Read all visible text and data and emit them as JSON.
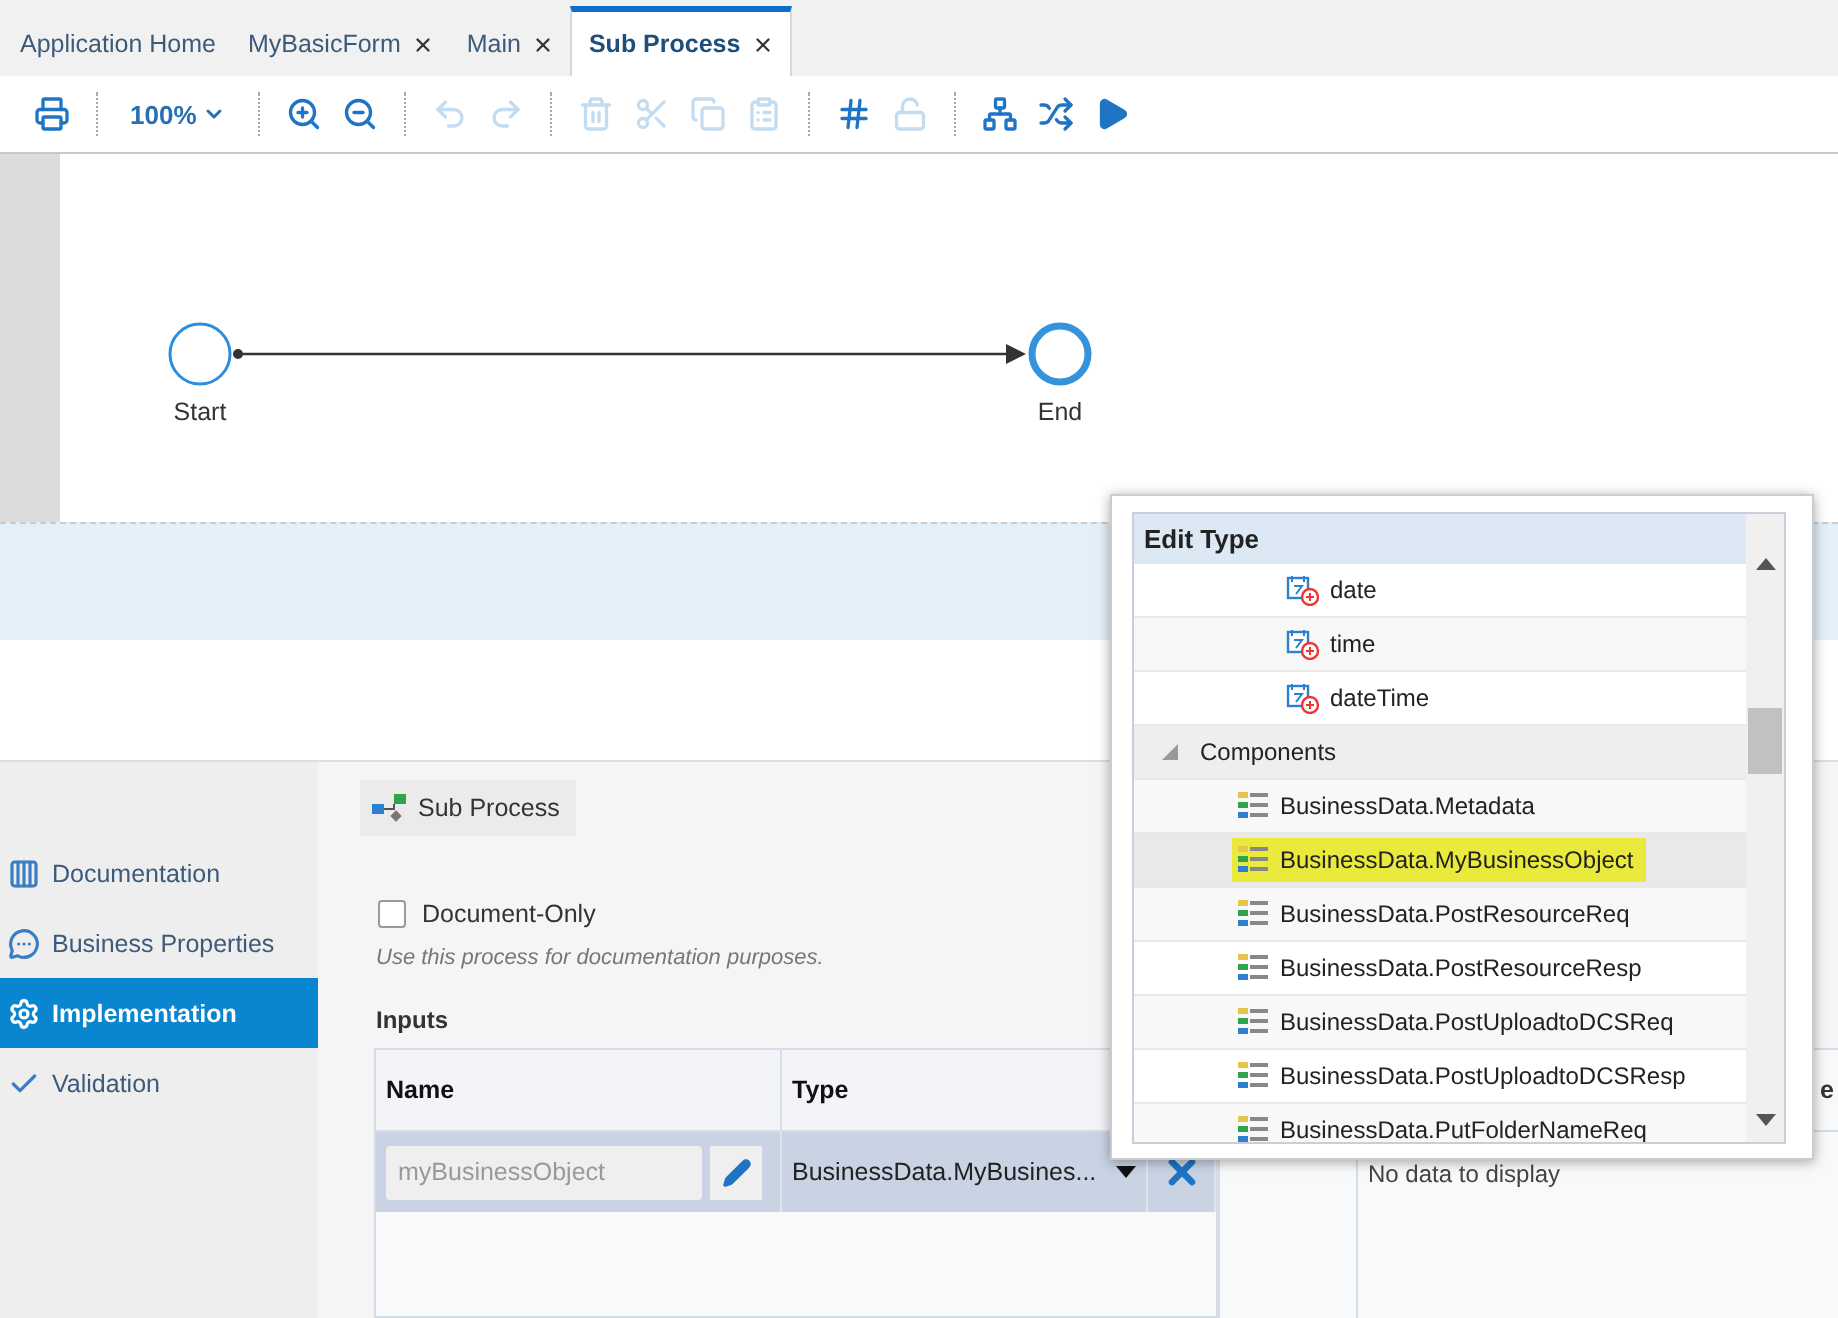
{
  "tabs": [
    {
      "label": "Application Home",
      "closable": false,
      "selected": false
    },
    {
      "label": "MyBasicForm",
      "closable": true,
      "selected": false
    },
    {
      "label": "Main",
      "closable": true,
      "selected": false
    },
    {
      "label": "Sub Process",
      "closable": true,
      "selected": true
    }
  ],
  "toolbar": {
    "zoom": "100%",
    "tools": [
      {
        "kind": "print",
        "disabled": false
      },
      {
        "kind": "zoom-in",
        "disabled": false
      },
      {
        "kind": "zoom-out",
        "disabled": false
      },
      {
        "kind": "undo",
        "disabled": true
      },
      {
        "kind": "redo",
        "disabled": true
      },
      {
        "kind": "delete",
        "disabled": true
      },
      {
        "kind": "cut",
        "disabled": true
      },
      {
        "kind": "copy",
        "disabled": true
      },
      {
        "kind": "paste",
        "disabled": true
      },
      {
        "kind": "grid",
        "disabled": false
      },
      {
        "kind": "lock",
        "disabled": true
      },
      {
        "kind": "connect",
        "disabled": false
      },
      {
        "kind": "shuffle",
        "disabled": false
      },
      {
        "kind": "run",
        "disabled": false
      }
    ]
  },
  "diagram": {
    "start": "Start",
    "end": "End"
  },
  "sidebar": {
    "items": [
      {
        "label": "Documentation",
        "selected": false
      },
      {
        "label": "Business Properties",
        "selected": false
      },
      {
        "label": "Implementation",
        "selected": true
      },
      {
        "label": "Validation",
        "selected": false
      }
    ]
  },
  "panel": {
    "chip": "Sub Process",
    "checkbox": {
      "label": "Document-Only",
      "checked": false
    },
    "hint": "Use this process for documentation purposes.",
    "inputs": {
      "title": "Inputs",
      "columns": [
        "Name",
        "Type"
      ],
      "rows": [
        {
          "name": "myBusinessObject",
          "type": "BusinessData.MyBusines..."
        }
      ]
    },
    "outputs": {
      "column_2": "e",
      "empty": "No data to display"
    }
  },
  "popup": {
    "title": "Edit Type",
    "items": [
      {
        "label": "date",
        "kind": "type"
      },
      {
        "label": "time",
        "kind": "type"
      },
      {
        "label": "dateTime",
        "kind": "type"
      }
    ],
    "group": {
      "label": "Components",
      "expanded": true,
      "children": [
        {
          "label": "BusinessData.Metadata",
          "selected": false
        },
        {
          "label": "BusinessData.MyBusinessObject",
          "selected": true
        },
        {
          "label": "BusinessData.PostResourceReq",
          "selected": false
        },
        {
          "label": "BusinessData.PostResourceResp",
          "selected": false
        },
        {
          "label": "BusinessData.PostUploadtoDCSReq",
          "selected": false
        },
        {
          "label": "BusinessData.PostUploadtoDCSResp",
          "selected": false
        },
        {
          "label": "BusinessData.PutFolderNameReq",
          "selected": false
        }
      ]
    }
  }
}
